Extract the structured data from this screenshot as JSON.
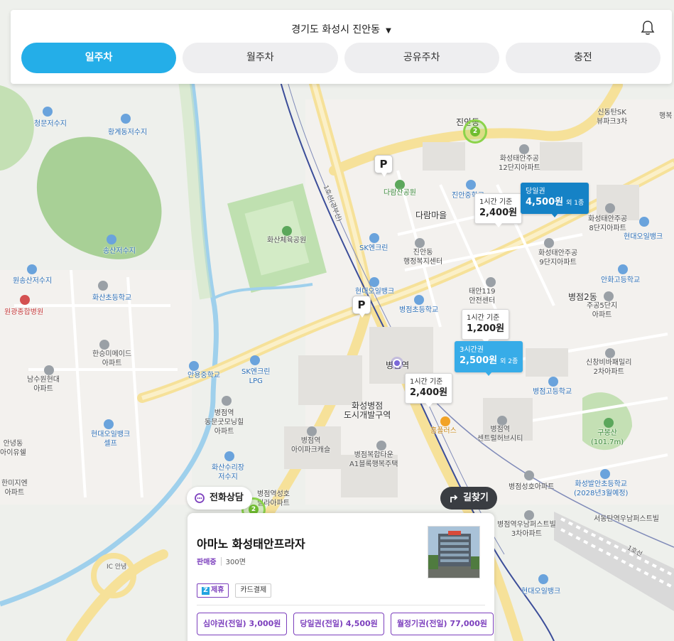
{
  "header": {
    "location": "경기도 화성시 진안동",
    "tabs": [
      {
        "label": "일주차",
        "active": true
      },
      {
        "label": "월주차",
        "active": false
      },
      {
        "label": "공유주차",
        "active": false
      },
      {
        "label": "충전",
        "active": false
      }
    ],
    "icons": {
      "caret": "caret-down-icon",
      "notifications": "bell-icon"
    }
  },
  "colors": {
    "accent": "#24aee8",
    "highlight_tag": "#1582c6",
    "highlight_tag_light": "#37ace8",
    "partner_purple": "#7c3fbd",
    "cluster_green": "#8bd34a"
  },
  "map": {
    "labels": {
      "cheongmun": "청문저수지",
      "hwanggye": "황계동저수지",
      "songsan": "송산저수지",
      "wonsongsan": "원송산저수지",
      "hwasan_school": "화산초등학교",
      "wongwang_hospital": "원광종합병원",
      "hanseung": "한승미메이드\n아파트",
      "namsu": "남수원현대\n아파트",
      "anyong_middle": "안용중학교",
      "sk_lpg": "SK엔크린\nLPG",
      "byeongjeom_apt": "병점역\n동문굿모닝힐\n아파트",
      "hyundai_oilbank_self": "현대오일뱅크\n셀프",
      "anyeong_dong": "안녕동\n아이유쉘",
      "hanmiji": "한미지엔\n아파트",
      "hwasan_lake": "화산수리장\n저수지",
      "hwasan_park": "화산체육공원",
      "darimsan": "다람산공원",
      "daram_village": "다람마을",
      "sk_encleen": "SK엔크린",
      "jinan_office": "진안동\n행정복지센터",
      "hyundai_oilbank": "현대오일뱅크",
      "taean119": "태안119\n안전센터",
      "byeongjeom_elem": "병점초등학교",
      "byeongjeom_station": "병점역",
      "byeongjeom_district": "화성병점\n도시개발구역",
      "ipark": "병점역\n아이파크캐슬",
      "complex_town": "병점복합타운\nA1블록행복주택",
      "homeplus": "홈플러스",
      "central_city": "병점역\n센트럴허브시티",
      "byeongjeom_seongho_villa": "병점역성호\n빌라아파트",
      "seongho_apt": "병점성호아파트",
      "jinan_station_area": "진안동",
      "taean_12": "화성태안주공\n12단지아파트",
      "taean_8": "화성태안주공\n8단지아파트",
      "taean_9": "화성태안주공\n9단지아파트",
      "sinjong_sk": "신동탄SK\n뷰파크3차",
      "hyundai_oilbank_r": "현대오일뱅크",
      "anhwa_high": "안화고등학교",
      "byeongjeom2": "병점2동",
      "jugong5": "주공5단지\n아파트",
      "sincheong": "신창비바패밀리\n2차아파트",
      "byeongjeom_high": "병점고등학교",
      "gubongsan": "구봉산\n(101.7m)",
      "balan_high": "화성발안초등학교\n(2028년3월예정)",
      "pure_apt": "병점역우남퍼스트빌\n3차아파트",
      "seodongtan": "서동탄역우남퍼스트빌",
      "hyundai_oilbank_b": "현대오일뱅크",
      "line1_a": "1호선(경부선)",
      "line1_b": "1호선",
      "anyeong_ic": "IC 안녕",
      "jinan_jchc": "진안중학교",
      "haengbok": "행복"
    }
  },
  "price_tags": [
    {
      "line1": "1시간 기준",
      "line2": "2,400원",
      "highlight": false
    },
    {
      "line1": "당일권",
      "line2": "4,500원",
      "extra": "외 1종",
      "highlight": true
    },
    {
      "line1": "1시간 기준",
      "line2": "1,200원",
      "highlight": false
    },
    {
      "line1": "3시간권",
      "line2": "2,500원",
      "extra": "외 2종",
      "highlight": true
    },
    {
      "line1": "1시간 기준",
      "line2": "2,400원",
      "highlight": false
    }
  ],
  "markers": {
    "parking": "P",
    "cluster_a": "2",
    "cluster_b": "2"
  },
  "actions": {
    "call": "전화상담",
    "navigate": "길찾기"
  },
  "card": {
    "name": "아마노 화성태안프라자",
    "status": "판매중",
    "spaces": "300면",
    "tags": [
      {
        "label": "제휴",
        "icon": "partner-z-icon"
      },
      {
        "label": "카드결제"
      }
    ],
    "prices": [
      "심야권(전일) 3,000원",
      "당일권(전일) 4,500원",
      "월정기권(전일) 77,000원"
    ]
  }
}
